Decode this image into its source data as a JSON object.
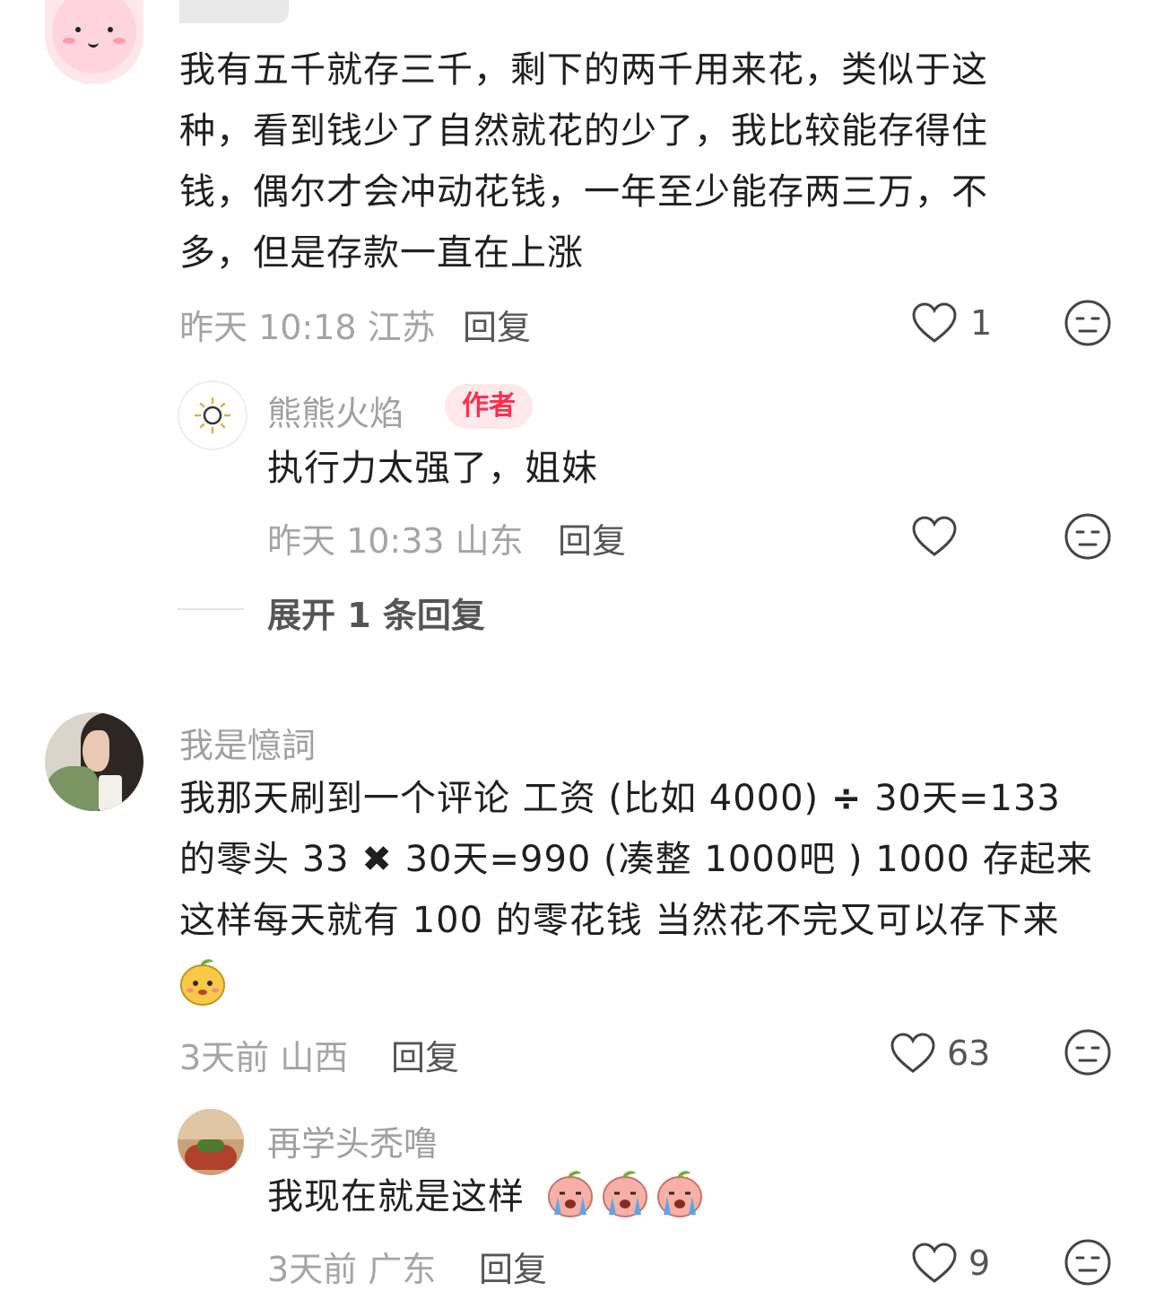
{
  "comments": [
    {
      "text_lines": [
        "我有五千就存三千，剩下的两千用来花，类似于这",
        "种，看到钱少了自然就花的少了，我比较能存得住",
        "钱，偶尔才会冲动花钱，一年至少能存两三万，不",
        "多，但是存款一直在上涨"
      ],
      "meta": "昨天 10:18 江苏",
      "reply_label": "回复",
      "likes": "1"
    },
    {
      "username": "熊熊火焰",
      "badge": "作者",
      "text": "执行力太强了，姐妹",
      "meta": "昨天 10:33 山东",
      "reply_label": "回复",
      "expand_label": "展开 1 条回复"
    },
    {
      "username": "我是憶詞",
      "line1_a": "我那天刷到一个评论 工资 (比如 4000)",
      "line1_op": "÷",
      "line1_b": "30天=133",
      "line2_a": "的零头 33",
      "line2_op": "✖",
      "line2_b": "30天=990 (凑整 1000吧 ) 1000 存起来",
      "line3": "这样每天就有 100 的零花钱 当然花不完又可以存下来",
      "meta": "3天前 山西",
      "reply_label": "回复",
      "likes": "63"
    },
    {
      "username": "再学头秃噜",
      "text": "我现在就是这样",
      "meta": "3天前 广东",
      "reply_label": "回复",
      "likes": "9"
    }
  ],
  "icons": {
    "like": "heart-outline-icon",
    "dislike": "neutral-face-icon"
  }
}
